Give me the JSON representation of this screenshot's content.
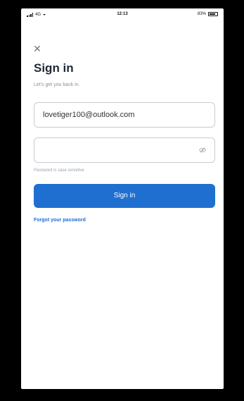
{
  "status_bar": {
    "carrier": "4G",
    "time": "12:13",
    "battery": "83%"
  },
  "header": {
    "title": "Sign in",
    "subtitle": "Let's get you back in."
  },
  "form": {
    "email_value": "lovetiger100@outlook.com",
    "password_value": "",
    "helper_text": "Password is case sensitive"
  },
  "actions": {
    "sign_in_label": "Sign in",
    "forgot_password_label": "Forgot your password"
  },
  "colors": {
    "primary": "#1f6fd1",
    "background": "#000000",
    "screen": "#ffffff"
  },
  "icons": {
    "close": "close-icon",
    "password_toggle": "eye-icon",
    "wifi": "wifi-icon",
    "battery": "battery-icon"
  }
}
